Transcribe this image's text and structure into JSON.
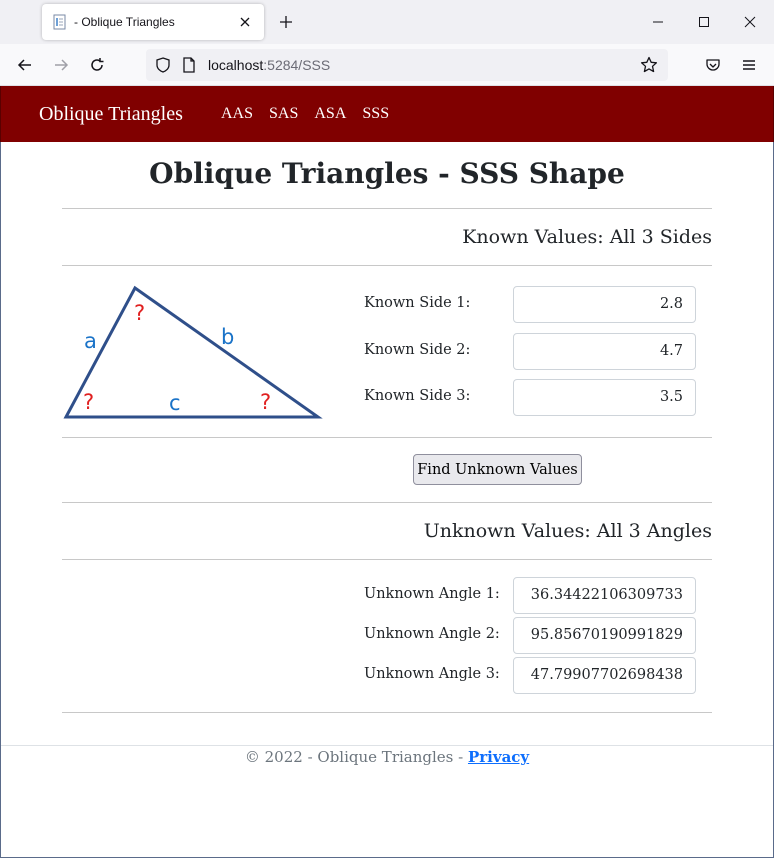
{
  "browser": {
    "tab_title": "- Oblique Triangles",
    "url_host": "localhost",
    "url_rest": ":5284/SSS"
  },
  "site": {
    "brand": "Oblique Triangles",
    "nav": [
      "AAS",
      "SAS",
      "ASA",
      "SSS"
    ]
  },
  "page": {
    "title": "Oblique Triangles - SSS Shape",
    "known_heading": "Known Values: All 3 Sides",
    "unknown_heading": "Unknown Values: All 3 Angles",
    "find_button": "Find Unknown Values"
  },
  "triangle": {
    "side_a": "a",
    "side_b": "b",
    "side_c": "c",
    "unknown_mark": "?"
  },
  "known": [
    {
      "label": "Known Side 1:",
      "value": "2.8"
    },
    {
      "label": "Known Side 2:",
      "value": "4.7"
    },
    {
      "label": "Known Side 3:",
      "value": "3.5"
    }
  ],
  "unknown": [
    {
      "label": "Unknown Angle 1:",
      "value": "36.34422106309733"
    },
    {
      "label": "Unknown Angle 2:",
      "value": "95.85670190991829"
    },
    {
      "label": "Unknown Angle 3:",
      "value": "47.79907702698438"
    }
  ],
  "footer": {
    "text": "© 2022 - Oblique Triangles - ",
    "privacy": "Privacy"
  },
  "colors": {
    "header_bg": "#800000",
    "triangle_stroke": "#2f4f8a",
    "side_label": "#1a73c8",
    "unknown_mark": "#e02020"
  }
}
